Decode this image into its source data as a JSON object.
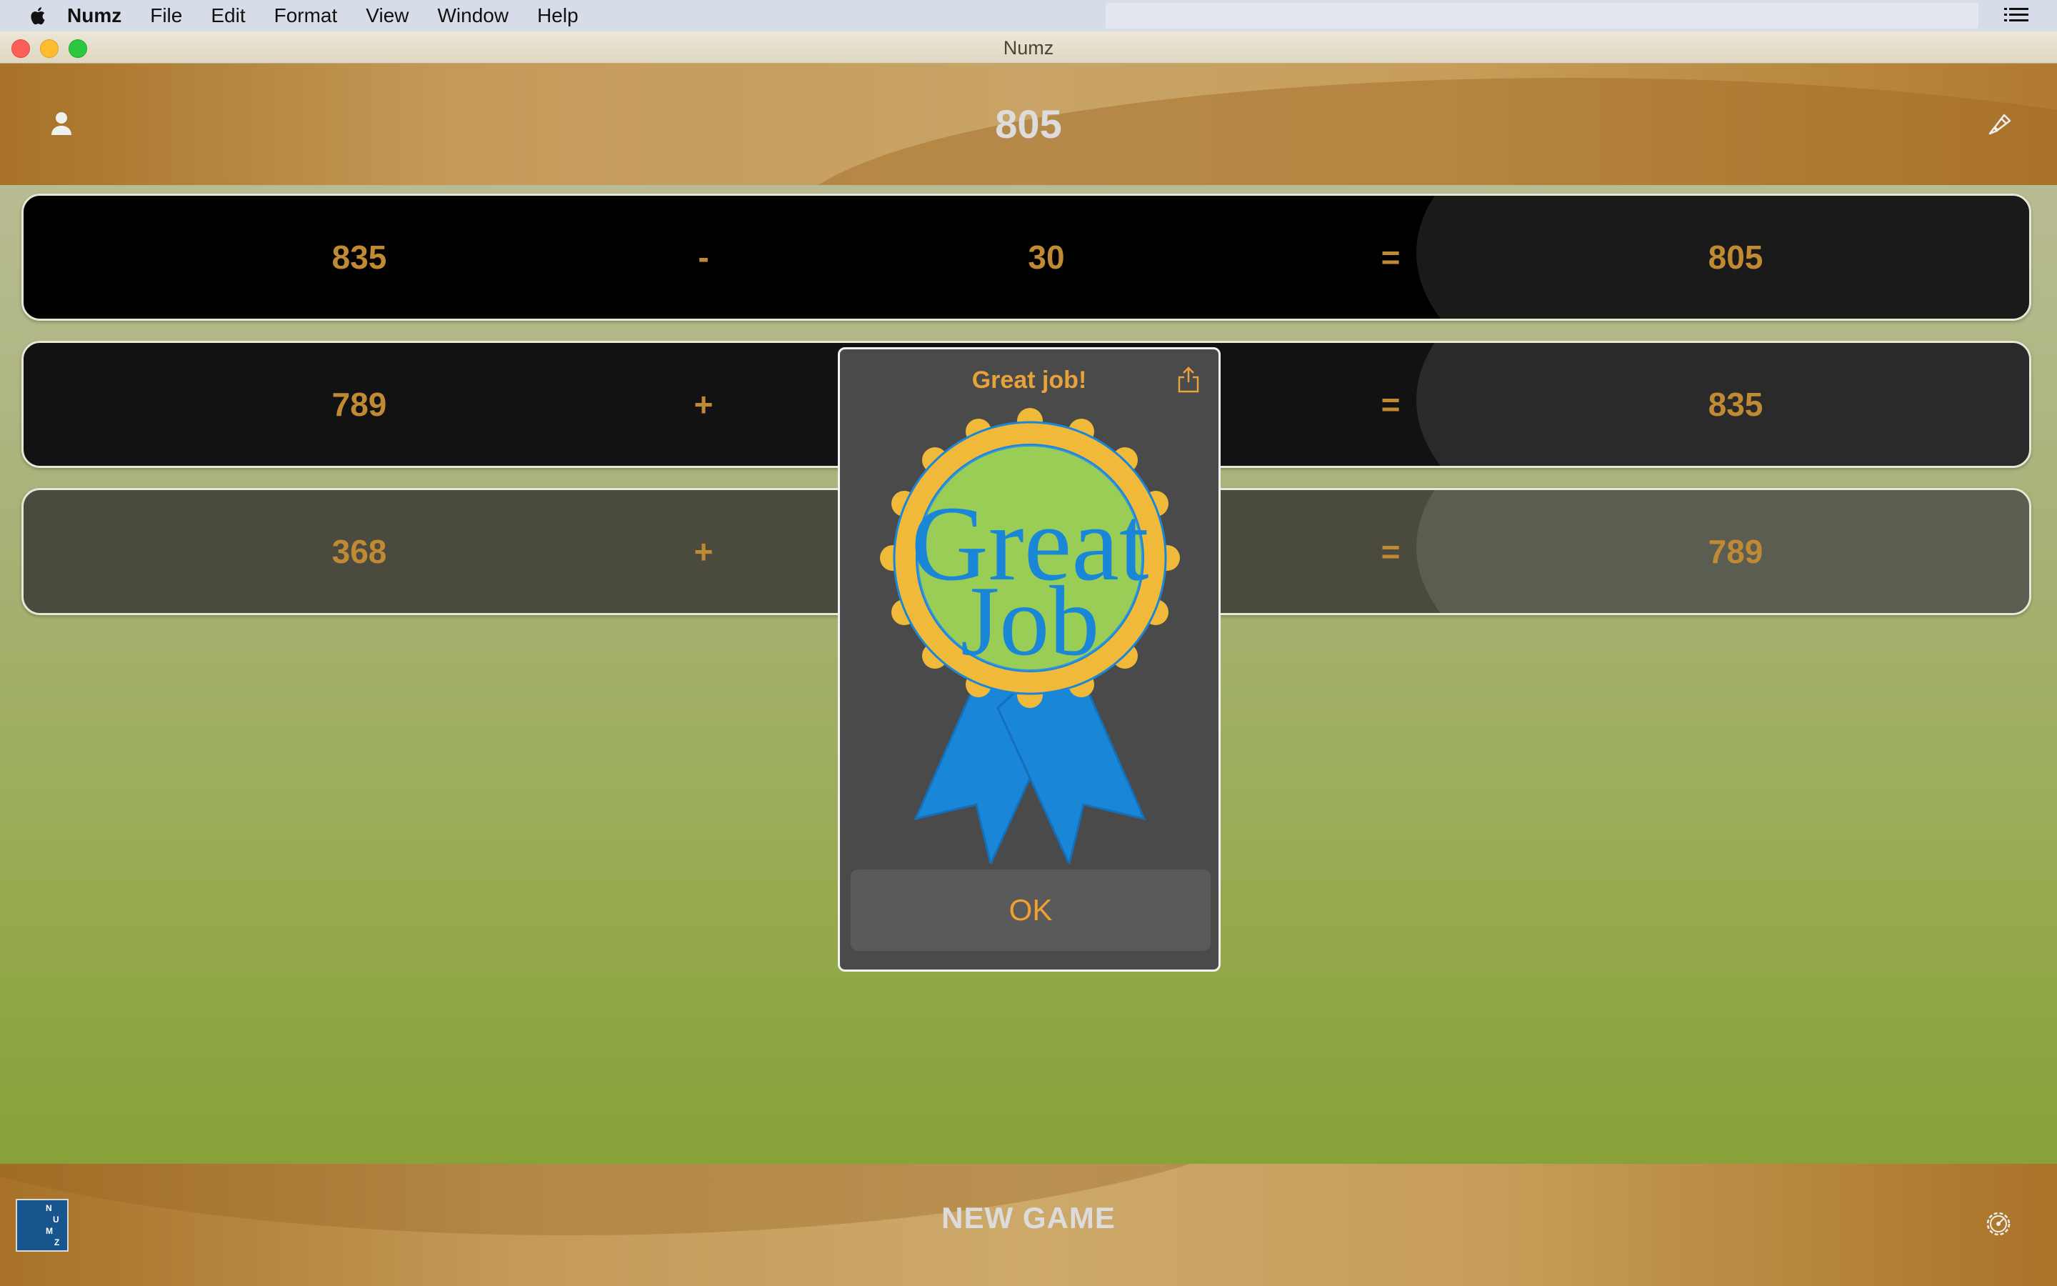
{
  "menubar": {
    "app_name": "Numz",
    "items": [
      "File",
      "Edit",
      "Format",
      "View",
      "Window",
      "Help"
    ]
  },
  "window": {
    "title": "Numz"
  },
  "header": {
    "target": "805"
  },
  "rows": [
    {
      "a": "835",
      "op": "-",
      "b": "30",
      "eq": "=",
      "result": "805"
    },
    {
      "a": "789",
      "op": "+",
      "b": "",
      "eq": "=",
      "result": "835"
    },
    {
      "a": "368",
      "op": "+",
      "b": "",
      "eq": "=",
      "result": "789"
    }
  ],
  "dialog": {
    "title": "Great job!",
    "badge_text_1": "Great",
    "badge_text_2": "Job",
    "ok_label": "OK"
  },
  "footer": {
    "new_game_label": "NEW GAME",
    "logo_letters": [
      "N",
      "U",
      "M",
      "Z"
    ]
  },
  "colors": {
    "number_orange": "#c08a35",
    "dialog_orange": "#e8a23a",
    "ribbon_blue": "#1a86d8",
    "medal_gold": "#f0b93a",
    "medal_green": "#8cc63f"
  }
}
